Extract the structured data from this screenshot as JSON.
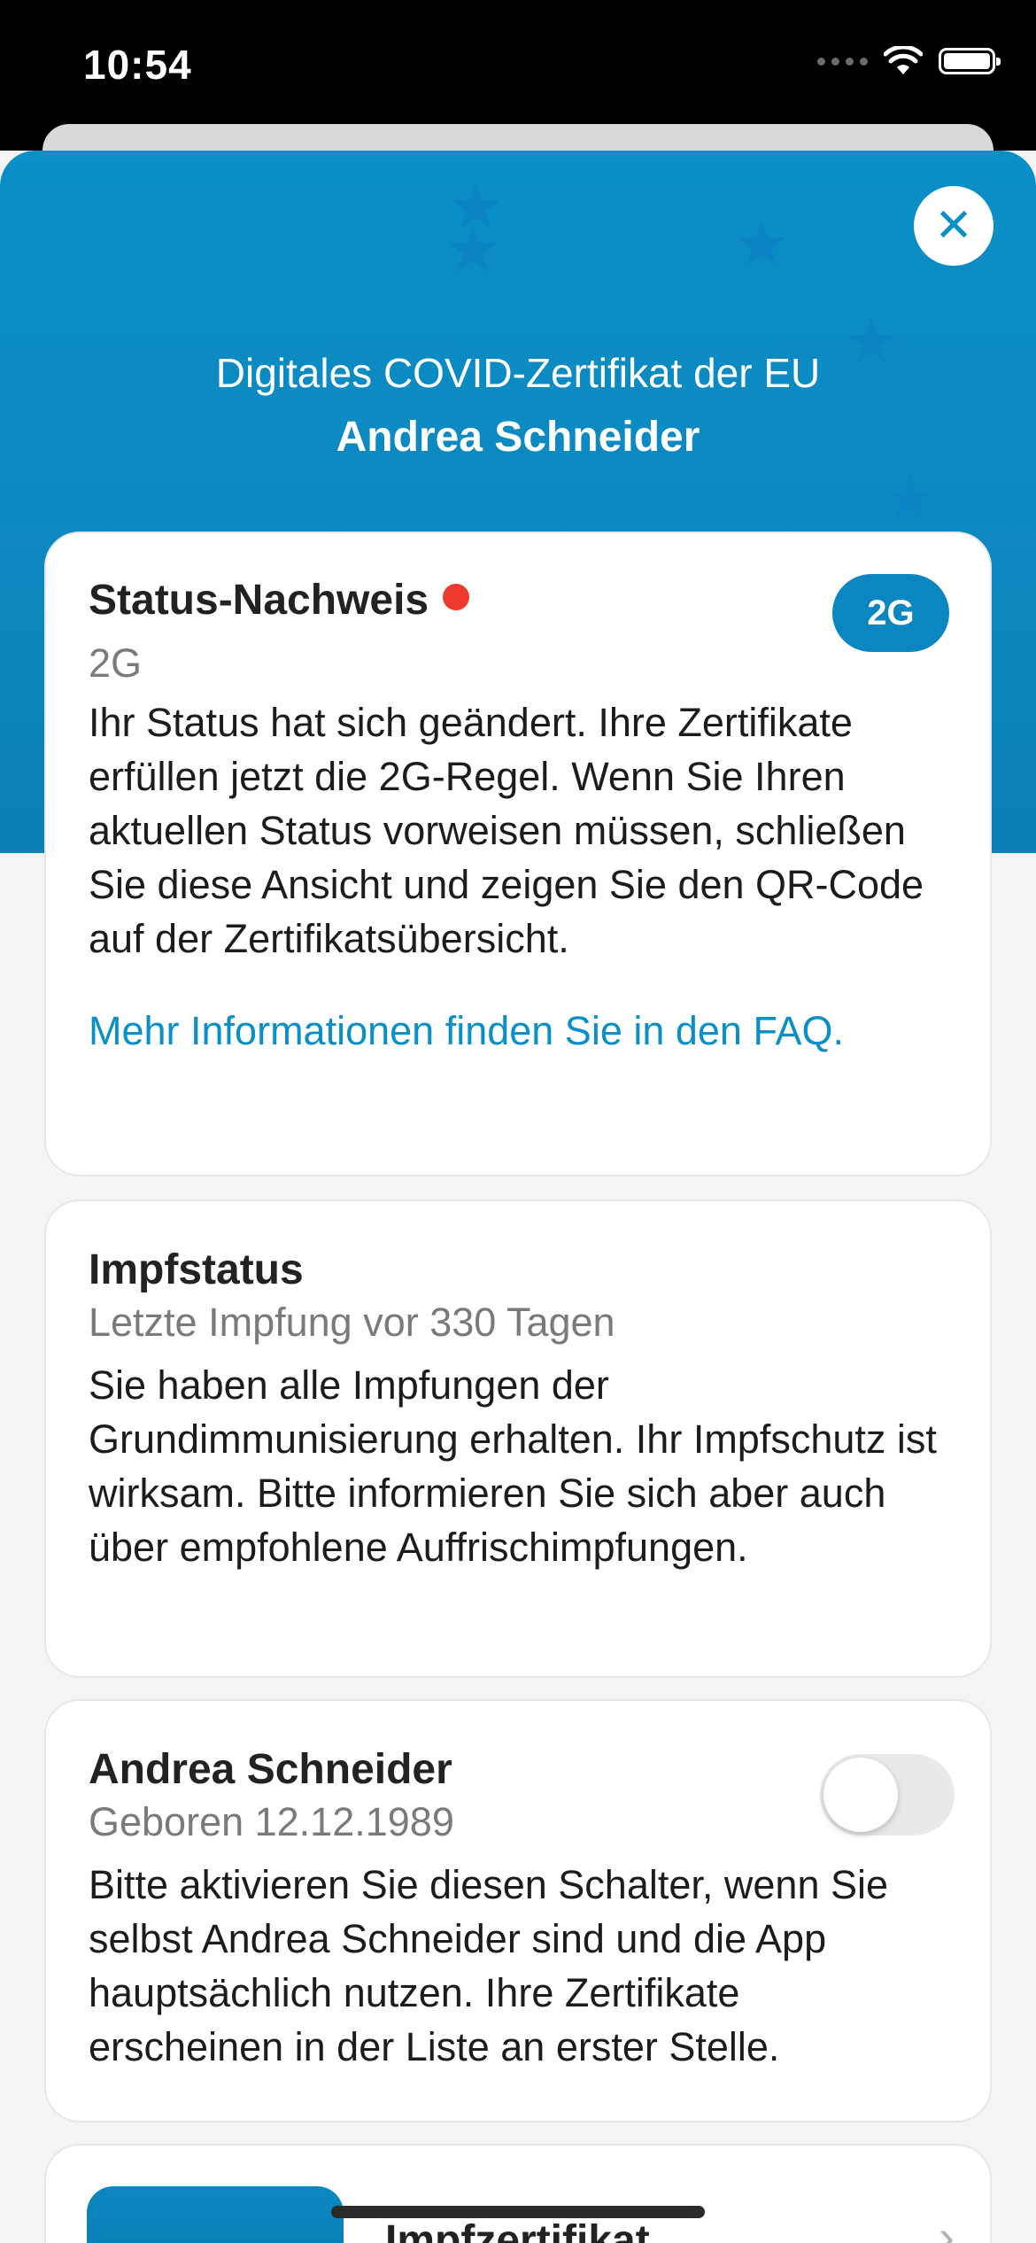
{
  "status_bar": {
    "time": "10:54"
  },
  "header": {
    "title": "Digitales COVID-Zertifikat der EU",
    "name": "Andrea Schneider",
    "close_symbol": "✕"
  },
  "status_card": {
    "title": "Status-Nachweis",
    "badge": "2G",
    "subtitle": "2G",
    "body": "Ihr Status hat sich geändert. Ihre Zertifikate erfüllen jetzt die 2G-Regel. Wenn Sie Ihren aktuellen Status vorweisen müssen, schließen Sie diese Ansicht und zeigen Sie den QR-Code auf der Zertifikatsübersicht.",
    "link": "Mehr Informationen finden Sie in den FAQ."
  },
  "vaccination_card": {
    "title": "Impfstatus",
    "subtitle": "Letzte Impfung vor 330 Tagen",
    "body": "Sie haben alle Impfungen der Grundimmunisierung erhalten. Ihr Impfschutz ist wirksam. Bitte informieren Sie sich aber auch über empfohlene Auffrischimpfungen."
  },
  "person_card": {
    "title": "Andrea Schneider",
    "subtitle": "Geboren 12.12.1989",
    "body": "Bitte aktivieren Sie diesen Schalter, wenn Sie selbst Andrea Schneider sind und die App hauptsächlich nutzen. Ihre Zertifikate erscheinen in der Liste an erster Stelle.",
    "toggle_on": false
  },
  "certificate_item": {
    "title": "Impfzertifikat",
    "chevron": "›"
  },
  "colors": {
    "brand_blue": "#0a8fc6",
    "status_dot": "#ee3a2e"
  }
}
